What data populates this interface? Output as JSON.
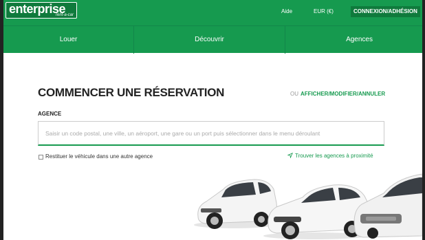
{
  "header": {
    "logo_text": "enterprise",
    "logo_subtext": "rent-a-car",
    "help_label": "Aide",
    "currency_label": "EUR (€)",
    "login_label": "CONNEXION/ADHÉSION"
  },
  "nav": {
    "items": [
      {
        "label": "Louer"
      },
      {
        "label": "Découvrir"
      },
      {
        "label": "Agences"
      }
    ]
  },
  "reservation": {
    "title": "COMMENCER UNE RÉSERVATION",
    "or_label": "OU",
    "manage_label": "AFFICHER/MODIFIER/ANNULER",
    "location_label": "AGENCE",
    "location_placeholder": "Saisir un code postal, une ville, un aéroport, une gare ou un port puis sélectionner dans le menu déroulant",
    "return_elsewhere_label": "Restituer le véhicule dans une autre agence",
    "find_nearby_label": "Trouver les agences à proximité"
  },
  "colors": {
    "brand_green": "#169a4f",
    "dark_green": "#0f7a3c"
  },
  "icons": {
    "nearby": "location-arrow-icon"
  }
}
